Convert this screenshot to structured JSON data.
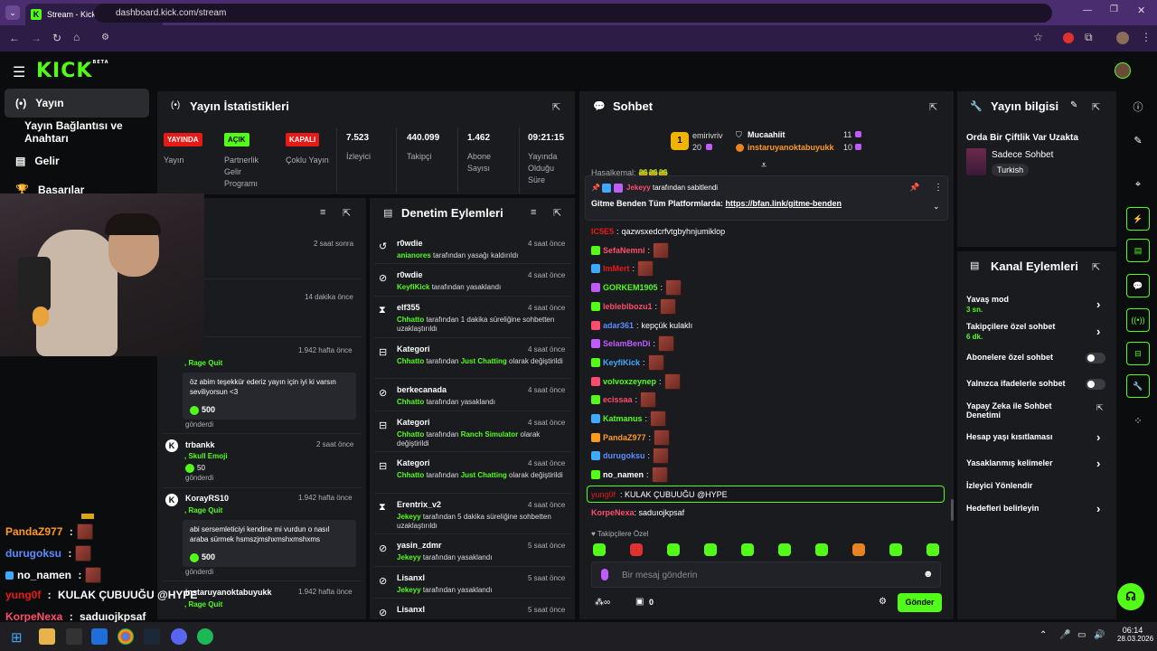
{
  "browser": {
    "tab_title": "Stream - Kick Dashboard",
    "url": "dashboard.kick.com/stream",
    "new_tab": "+"
  },
  "header": {
    "logo": "KICK",
    "logo_beta": "BETA"
  },
  "sidebar": {
    "items": [
      {
        "label": "Yayın",
        "icon": "broadcast-icon"
      },
      {
        "label": "Yayın Bağlantısı ve Anahtarı",
        "icon": "key-icon"
      },
      {
        "label": "Gelir",
        "icon": "chart-icon"
      },
      {
        "label": "Başarılar",
        "icon": "trophy-icon"
      }
    ]
  },
  "stats": {
    "title": "Yayın İstatistikleri",
    "badges": [
      {
        "text": "YAYINDA",
        "label": "Yayın",
        "color": "#e91916"
      },
      {
        "text": "AÇIK",
        "label": "Partnerlik Gelir Programı",
        "color": "#53fc18"
      },
      {
        "text": "KAPALI",
        "label": "Çoklu Yayın",
        "color": "#e91916"
      }
    ],
    "items": [
      {
        "value": "7.523",
        "label": "İzleyici"
      },
      {
        "value": "440.099",
        "label": "Takipçi"
      },
      {
        "value": "1.462",
        "label": "Abone Sayısı"
      },
      {
        "value": "09:21:15",
        "label": "Yayında Olduğu Süre"
      }
    ]
  },
  "activity": {
    "rows": [
      {
        "time": "2 saat sonra"
      },
      {
        "time": "14 dakika önce"
      },
      {
        "time": "1.942 hafta önce",
        "action": ", Rage Quit",
        "message": "öz abim teşekkür ederiz yayın için iyi ki varsın seviliyorsun <3",
        "amount": "500",
        "sent": "gönderdi"
      },
      {
        "user": "trbankk",
        "time": "2 saat önce",
        "action": ", Skull Emoji",
        "amount": "50",
        "sent": "gönderdi"
      },
      {
        "user": "KorayRS10",
        "time": "1.942 hafta önce",
        "action": ", Rage Quit",
        "message": "abi sersemleticiyi kendine mi vurdun o nasıl araba sürmek hsmszjmshxmshxmshxms",
        "amount": "500",
        "sent": "gönderdi"
      },
      {
        "user": "instaruyanoktabuyukk",
        "time": "1.942 hafta önce",
        "action": ", Rage Quit"
      }
    ]
  },
  "moderation": {
    "title": "Denetim Eylemleri",
    "rows": [
      {
        "user": "r0wdie",
        "time": "4 saat önce",
        "actor": "anianores",
        "text": " tarafından yasağı kaldırıldı",
        "icon": "undo-icon"
      },
      {
        "user": "r0wdie",
        "time": "4 saat önce",
        "actor": "KeyfiKick",
        "text": " tarafından yasaklandı",
        "icon": "ban-icon"
      },
      {
        "user": "elf355",
        "time": "4 saat önce",
        "actor": "Chhatto",
        "text": " tarafından 1 dakika süreliğine sohbetten uzaklaştırıldı",
        "icon": "hourglass-icon"
      },
      {
        "user": "Kategori",
        "time": "4 saat önce",
        "actor": "Chhatto",
        "text": " tarafından ",
        "hl": "Just Chatting",
        "text2": " olarak değiştirildi",
        "icon": "category-icon"
      },
      {
        "user": "berkecanada",
        "time": "4 saat önce",
        "actor": "Chhatto",
        "text": " tarafından yasaklandı",
        "icon": "ban-icon"
      },
      {
        "user": "Kategori",
        "time": "4 saat önce",
        "actor": "Chhatto",
        "text": " tarafından ",
        "hl": "Ranch Simulator",
        "text2": " olarak değiştirildi",
        "icon": "category-icon"
      },
      {
        "user": "Kategori",
        "time": "4 saat önce",
        "actor": "Chhatto",
        "text": " tarafından ",
        "hl": "Just Chatting",
        "text2": " olarak değiştirildi",
        "icon": "category-icon"
      },
      {
        "user": "Erentrix_v2",
        "time": "4 saat önce",
        "actor": "Jekeyy",
        "text": " tarafından 5 dakika süreliğine sohbetten uzaklaştırıldı",
        "icon": "hourglass-icon"
      },
      {
        "user": "yasin_zdmr",
        "time": "5 saat önce",
        "actor": "Jekeyy",
        "text": " tarafından yasaklandı",
        "icon": "ban-icon"
      },
      {
        "user": "Lisanxl",
        "time": "5 saat önce",
        "actor": "Jekeyy",
        "text": " tarafından yasaklandı",
        "icon": "ban-icon"
      },
      {
        "user": "Lisanxl",
        "time": "5 saat önce",
        "actor": "",
        "text": "",
        "icon": "ban-icon"
      }
    ]
  },
  "chat": {
    "title": "Sohbet",
    "leaderboard": [
      {
        "rank": "1",
        "name": "emirivriv",
        "count": "20"
      },
      {
        "name": "Mucaahiit",
        "count": "11"
      },
      {
        "name": "instaruyanoktabuyukk",
        "count": "10"
      }
    ],
    "partial_line": "Hasalkemal: 🐸🐸🐸",
    "pinned": {
      "by_user": "Jekeyy",
      "by_text": " tarafından sabitlendi",
      "message_prefix": "Gitme Benden Tüm Platformlarda: ",
      "link": "https://bfan.link/gitme-benden"
    },
    "messages": [
      {
        "user": "IC5E5",
        "color": "#e91916",
        "text": "qazwsxedcrfvtgbyhnjumiklop",
        "emote": false
      },
      {
        "user": "SefaNemni",
        "color": "#ff4d6d",
        "text": "",
        "emote": true
      },
      {
        "user": "lmMert",
        "color": "#e91916",
        "text": "",
        "emote": true
      },
      {
        "user": "GORKEM1905",
        "color": "#53fc18",
        "text": "",
        "emote": true
      },
      {
        "user": "lebleblbozu1",
        "color": "#ff4d6d",
        "text": "",
        "emote": true
      },
      {
        "user": "adar361",
        "color": "#5b8cff",
        "text": "kepçük kulaklı",
        "emote": false
      },
      {
        "user": "SelamBenDi",
        "color": "#c05cff",
        "text": "",
        "emote": true
      },
      {
        "user": "KeyfiKick",
        "color": "#3fa9ff",
        "text": "",
        "emote": true
      },
      {
        "user": "volvoxzeynep",
        "color": "#53fc18",
        "text": "",
        "emote": true
      },
      {
        "user": "ecissaa",
        "color": "#ff4d6d",
        "text": "",
        "emote": true
      },
      {
        "user": "Katmanus",
        "color": "#53fc18",
        "text": "",
        "emote": true
      },
      {
        "user": "PandaZ977",
        "color": "#ff9a1f",
        "text": "",
        "emote": true
      },
      {
        "user": "durugoksu",
        "color": "#5b8cff",
        "text": "",
        "emote": true
      },
      {
        "user": "no_namen",
        "color": "#ffffff",
        "text": "",
        "emote": true
      }
    ],
    "highlight": {
      "user": "yung0f",
      "text": "KULAK ÇUBUUĞU @HYPE"
    },
    "last": {
      "user": "KorpeNexa",
      "text": "saduıojkpsaf"
    },
    "followers_only": "Takipçilere Özel",
    "input_placeholder": "Bir mesaj gönderin",
    "viewer_count": "0",
    "send_label": "Gönder"
  },
  "info": {
    "title": "Yayın bilgisi",
    "stream_title": "Orda Bir Çiftlik Var Uzakta",
    "category": "Sadece Sohbet",
    "language": "Turkish"
  },
  "channel": {
    "title": "Kanal Eylemleri",
    "items": [
      {
        "label": "Yavaş mod",
        "sub": "3 sn.",
        "kind": "chevron"
      },
      {
        "label": "Takipçilere özel sohbet",
        "sub": "6 dk.",
        "kind": "chevron"
      },
      {
        "label": "Abonelere özel sohbet",
        "sub": "",
        "kind": "toggle"
      },
      {
        "label": "Yalnızca ifadelerle sohbet",
        "sub": "",
        "kind": "toggle"
      },
      {
        "label": "Yapay Zeka ile Sohbet Denetimi",
        "sub": "",
        "kind": "external"
      },
      {
        "label": "Hesap yaşı kısıtlaması",
        "sub": "",
        "kind": "chevron"
      },
      {
        "label": "Yasaklanmış kelimeler",
        "sub": "",
        "kind": "chevron"
      },
      {
        "label": "İzleyici Yönlendir",
        "sub": "",
        "kind": "none"
      },
      {
        "label": "Hedefleri belirleyin",
        "sub": "",
        "kind": "chevron"
      }
    ]
  },
  "overlay_chat": [
    {
      "user": "PandaZ977",
      "sep": " :",
      "text": "",
      "color": "#ff9a1f"
    },
    {
      "user": "durugoksu",
      "sep": " :",
      "text": "",
      "color": "#5b8cff"
    },
    {
      "user": "no_namen",
      "sep": " :",
      "text": "",
      "color": "#ffffff"
    },
    {
      "user": "yung0f",
      "sep": " : ",
      "text": "KULAK ÇUBUUĞU @HYPE",
      "color": "#e91916"
    },
    {
      "user": "KorpeNexa",
      "sep": " : ",
      "text": "saduıojkpsaf",
      "color": "#ff4d6d"
    }
  ],
  "taskbar": {
    "time": "06:14",
    "date": "28.03.2026"
  }
}
